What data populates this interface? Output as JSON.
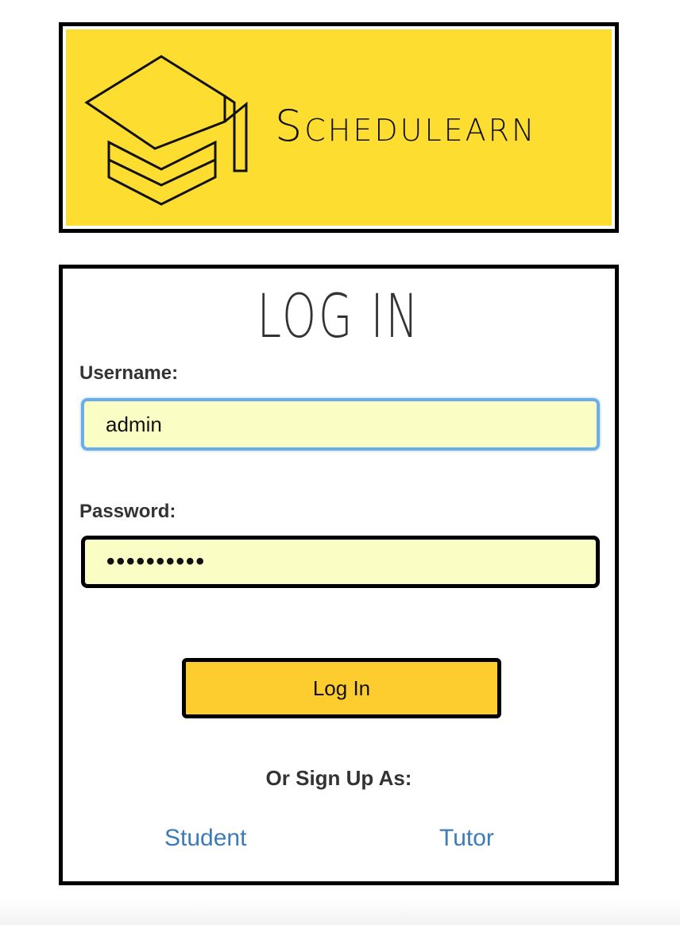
{
  "brand": {
    "name": "Schedulearn",
    "logo_icon": "graduation-cap-icon",
    "background_color": "#fedd31"
  },
  "login": {
    "title": "LOG IN",
    "username_label": "Username:",
    "username_value": "admin",
    "password_label": "Password:",
    "password_value": "••••••••••",
    "submit_label": "Log In",
    "signup_prompt": "Or Sign Up As:",
    "signup_options": [
      "Student",
      "Tutor"
    ]
  },
  "colors": {
    "input_background": "#fbfec4",
    "focus_border": "#6aaee9",
    "button_background": "#fdcd30",
    "link": "#3d7ab8"
  }
}
